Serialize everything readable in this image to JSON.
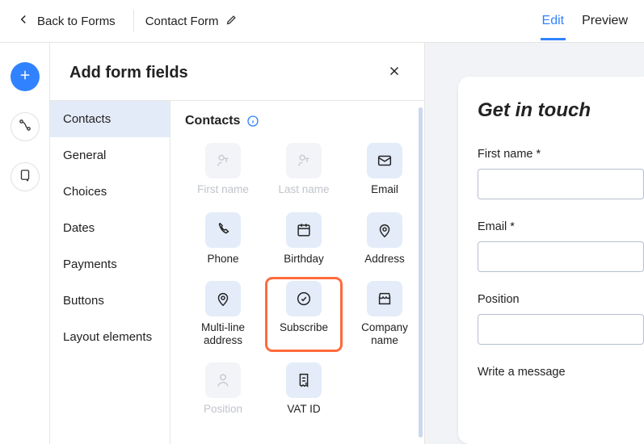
{
  "header": {
    "back_label": "Back to Forms",
    "form_title": "Contact Form",
    "tabs": {
      "edit": "Edit",
      "preview": "Preview"
    }
  },
  "panel": {
    "title": "Add form fields",
    "section_title": "Contacts"
  },
  "categories": [
    {
      "id": "contacts",
      "label": "Contacts",
      "active": true
    },
    {
      "id": "general",
      "label": "General",
      "active": false
    },
    {
      "id": "choices",
      "label": "Choices",
      "active": false
    },
    {
      "id": "dates",
      "label": "Dates",
      "active": false
    },
    {
      "id": "payments",
      "label": "Payments",
      "active": false
    },
    {
      "id": "buttons",
      "label": "Buttons",
      "active": false
    },
    {
      "id": "layout",
      "label": "Layout elements",
      "active": false
    }
  ],
  "fields": [
    {
      "id": "first-name",
      "label": "First name",
      "icon": "person-t",
      "disabled": true
    },
    {
      "id": "last-name",
      "label": "Last name",
      "icon": "person-t",
      "disabled": true
    },
    {
      "id": "email",
      "label": "Email",
      "icon": "envelope",
      "disabled": false
    },
    {
      "id": "phone",
      "label": "Phone",
      "icon": "phone",
      "disabled": false
    },
    {
      "id": "birthday",
      "label": "Birthday",
      "icon": "calendar",
      "disabled": false
    },
    {
      "id": "address",
      "label": "Address",
      "icon": "pin",
      "disabled": false
    },
    {
      "id": "multi-addr",
      "label": "Multi-line address",
      "icon": "pin",
      "disabled": false
    },
    {
      "id": "subscribe",
      "label": "Subscribe",
      "icon": "check-circle",
      "disabled": false,
      "highlight": true
    },
    {
      "id": "company",
      "label": "Company name",
      "icon": "store",
      "disabled": false
    },
    {
      "id": "position",
      "label": "Position",
      "icon": "person",
      "disabled": true
    },
    {
      "id": "vat",
      "label": "VAT ID",
      "icon": "receipt",
      "disabled": false
    }
  ],
  "preview_form": {
    "heading": "Get in touch",
    "fields": [
      {
        "label": "First name *"
      },
      {
        "label": "Email *"
      },
      {
        "label": "Position"
      },
      {
        "label": "Write a message"
      }
    ]
  }
}
